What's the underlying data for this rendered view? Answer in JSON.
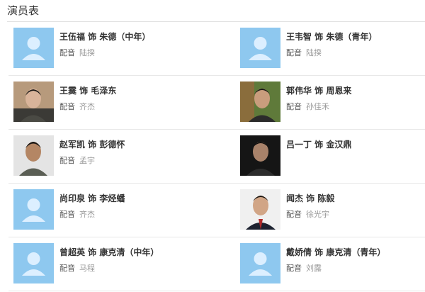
{
  "section_title": "演员表",
  "voice_label": "配音",
  "cast": [
    {
      "name": "王伍福 饰 朱德（中年）",
      "voice_actor": "陆揆",
      "avatar": "placeholder-avatar-icon"
    },
    {
      "name": "王韦智 饰 朱德（青年）",
      "voice_actor": "陆揆",
      "avatar": "placeholder-avatar-icon"
    },
    {
      "name": "王霙 饰 毛泽东",
      "voice_actor": "齐杰",
      "avatar": "photo"
    },
    {
      "name": "郭伟华 饰 周恩来",
      "voice_actor": "孙佳禾",
      "avatar": "photo"
    },
    {
      "name": "赵军凯 饰 彭德怀",
      "voice_actor": "孟宇",
      "avatar": "photo"
    },
    {
      "name": "吕一丁 饰 金汉鼎",
      "voice_actor": "",
      "avatar": "photo"
    },
    {
      "name": "尚印泉 饰 李烃蟠",
      "voice_actor": "齐杰",
      "avatar": "placeholder-avatar-icon"
    },
    {
      "name": "闻杰 饰 陈毅",
      "voice_actor": "徐光宇",
      "avatar": "photo"
    },
    {
      "name": "曾超英 饰 康克清（中年）",
      "voice_actor": "马程",
      "avatar": "placeholder-avatar-icon"
    },
    {
      "name": "戴娇倩 饰 康克清（青年）",
      "voice_actor": "刘露",
      "avatar": "placeholder-avatar-icon"
    }
  ]
}
